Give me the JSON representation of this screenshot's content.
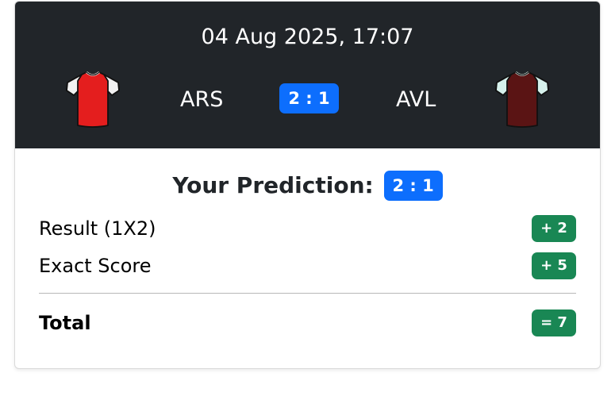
{
  "match": {
    "date": "04 Aug 2025, 17:07",
    "home_team": {
      "code": "ARS",
      "jersey_icon": "red-white-jersey-icon",
      "color": "#e41e1e"
    },
    "away_team": {
      "code": "AVL",
      "jersey_icon": "claret-blue-jersey-icon",
      "color": "#5a1414"
    },
    "score": "2 : 1"
  },
  "prediction": {
    "label": "Your Prediction:",
    "score": "2 : 1"
  },
  "points": {
    "result_label": "Result (1X2)",
    "result_points": "+ 2",
    "exact_label": "Exact Score",
    "exact_points": "+ 5",
    "total_label": "Total",
    "total_points": "= 7"
  },
  "colors": {
    "header_bg": "#212529",
    "badge_blue": "#0d6efd",
    "badge_green": "#198754"
  }
}
